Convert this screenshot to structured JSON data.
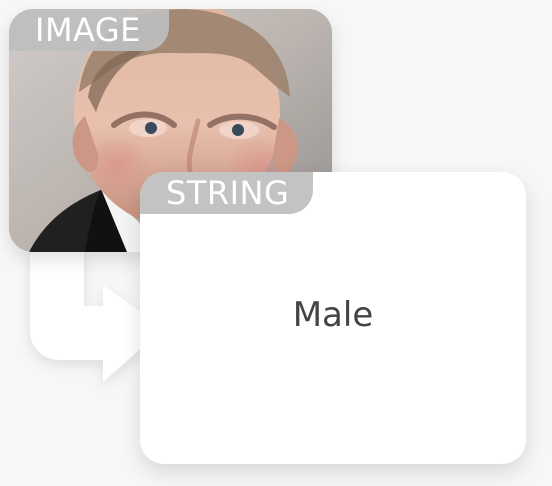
{
  "input": {
    "tag_label": "IMAGE",
    "image_subject": "portrait-photo"
  },
  "output": {
    "tag_label": "STRING",
    "value": "Male"
  },
  "flow": {
    "icon": "right-turn-arrow-icon"
  }
}
